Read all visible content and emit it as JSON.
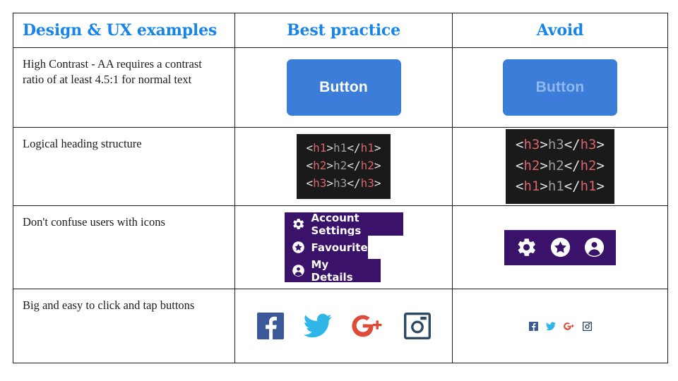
{
  "table": {
    "headers": [
      {
        "id": "col-examples",
        "label": "Design & UX examples"
      },
      {
        "id": "col-best",
        "label": "Best practice"
      },
      {
        "id": "col-avoid",
        "label": "Avoid"
      }
    ],
    "header_color": "#1784e8",
    "border_color": "#1d1d1d",
    "rows": [
      {
        "id": "row-high-contrast",
        "description": "High Contrast - AA requires a contrast ratio of at least 4.5:1 for normal text",
        "best": {
          "type": "button",
          "label": "Button",
          "background": "#3b7dd8",
          "text_color": "#ffffff"
        },
        "avoid": {
          "type": "button",
          "label": "Button",
          "background": "#3b7dd8",
          "text_color": "#8fb9ee"
        }
      },
      {
        "id": "row-heading-structure",
        "description": "Logical heading structure",
        "best": {
          "type": "code",
          "background": "#1a1a1a",
          "bracket_color": "#e3e3e3",
          "tag_color": "#d9636b",
          "text_color": "#9d9d9d",
          "lines": [
            {
              "open_tag": "h1",
              "content": "h1",
              "close_tag": "h1"
            },
            {
              "open_tag": "h2",
              "content": "h2",
              "close_tag": "h2"
            },
            {
              "open_tag": "h3",
              "content": "h3",
              "close_tag": "h3"
            }
          ]
        },
        "avoid": {
          "type": "code",
          "background": "#1a1a1a",
          "bracket_color": "#e3e3e3",
          "tag_color": "#d9636b",
          "text_color": "#9d9d9d",
          "lines": [
            {
              "open_tag": "h3",
              "content": "h3",
              "close_tag": "h3"
            },
            {
              "open_tag": "h2",
              "content": "h2",
              "close_tag": "h2"
            },
            {
              "open_tag": "h1",
              "content": "h1",
              "close_tag": "h1"
            }
          ]
        }
      },
      {
        "id": "row-icons",
        "description": "Don't confuse users with icons",
        "best": {
          "type": "menu",
          "background": "#3a1269",
          "text_color": "#ffffff",
          "items": [
            {
              "icon": "gear-icon",
              "label": "Account Settings"
            },
            {
              "icon": "star-circle-icon",
              "label": "Favourited"
            },
            {
              "icon": "person-circle-icon",
              "label": "My Details"
            }
          ]
        },
        "avoid": {
          "type": "icon-bar",
          "background": "#3a1269",
          "icon_color": "#ffffff",
          "items": [
            {
              "icon": "gear-icon"
            },
            {
              "icon": "star-circle-icon"
            },
            {
              "icon": "person-circle-icon"
            }
          ]
        }
      },
      {
        "id": "row-tap-targets",
        "description": "Big and easy to click and tap buttons",
        "best": {
          "type": "social",
          "size": "large",
          "items": [
            {
              "icon": "facebook-icon",
              "color": "#3b5998"
            },
            {
              "icon": "twitter-icon",
              "color": "#2fb6e8"
            },
            {
              "icon": "googleplus-icon",
              "color": "#dd4b39"
            },
            {
              "icon": "instagram-icon",
              "color": "#2e4a62"
            }
          ]
        },
        "avoid": {
          "type": "social",
          "size": "small",
          "items": [
            {
              "icon": "facebook-icon",
              "color": "#3b5998"
            },
            {
              "icon": "twitter-icon",
              "color": "#2fb6e8"
            },
            {
              "icon": "googleplus-icon",
              "color": "#dd4b39"
            },
            {
              "icon": "instagram-icon",
              "color": "#2e4a62"
            }
          ]
        }
      }
    ]
  }
}
